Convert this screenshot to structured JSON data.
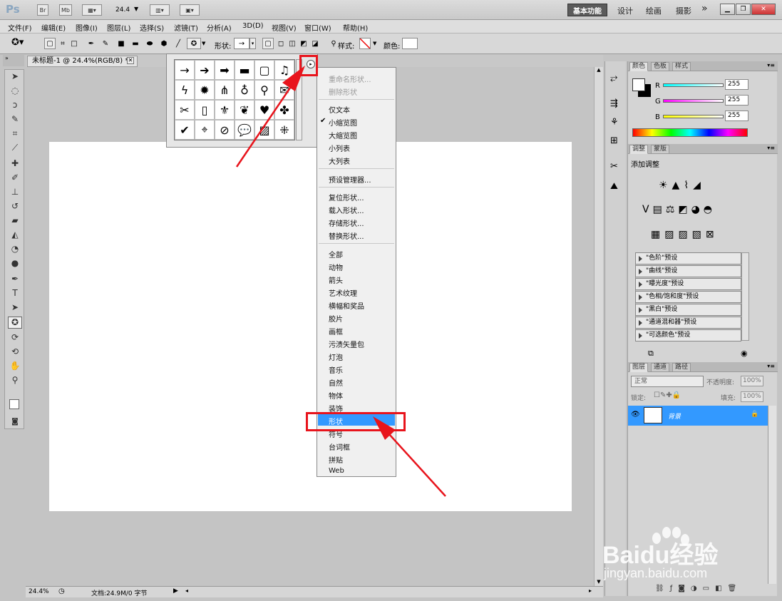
{
  "app": {
    "logo": "Ps",
    "launch_br": "Br",
    "launch_mb": "Mb",
    "zoom_value": "24.4",
    "workspaces": {
      "active": "基本功能",
      "items": [
        "设计",
        "绘画",
        "摄影"
      ],
      "more": "»"
    }
  },
  "menubar": [
    "文件(F)",
    "编辑(E)",
    "图像(I)",
    "图层(L)",
    "选择(S)",
    "滤镜(T)",
    "分析(A)",
    "3D(D)",
    "视图(V)",
    "窗口(W)",
    "帮助(H)"
  ],
  "options": {
    "shape_label": "形状:",
    "style_label": "样式:",
    "color_label": "颜色:"
  },
  "document": {
    "tab_title": "未标题-1 @ 24.4%(RGB/8) *",
    "status_zoom": "24.4%",
    "status_doc": "文档:24.9M/0 字节"
  },
  "context_menu": {
    "group1": [
      "重命名形状...",
      "删除形状"
    ],
    "group2": [
      "仅文本",
      "小缩览图",
      "大缩览图",
      "小列表",
      "大列表"
    ],
    "checked": "小缩览图",
    "group3": [
      "预设管理器..."
    ],
    "group4": [
      "复位形状...",
      "载入形状...",
      "存储形状...",
      "替换形状..."
    ],
    "group5": [
      "全部",
      "动物",
      "箭头",
      "艺术纹理",
      "横幅和奖品",
      "胶片",
      "画框",
      "污渍矢量包",
      "灯泡",
      "音乐",
      "自然",
      "物体",
      "装饰",
      "形状",
      "符号",
      "台词框",
      "拼贴",
      "Web"
    ],
    "highlighted": "形状"
  },
  "color_panel": {
    "tabs": [
      "颜色",
      "色板",
      "样式"
    ],
    "channels": [
      {
        "label": "R",
        "value": "255",
        "color": "#00ffff"
      },
      {
        "label": "G",
        "value": "255",
        "color": "#ff00ff"
      },
      {
        "label": "B",
        "value": "255",
        "color": "#ffff00"
      }
    ]
  },
  "adjust_panel": {
    "tabs": [
      "调整",
      "蒙版"
    ],
    "title": "添加调整",
    "presets": [
      "\"色阶\"预设",
      "\"曲线\"预设",
      "\"曝光度\"预设",
      "\"色相/饱和度\"预设",
      "\"黑白\"预设",
      "\"通道混和器\"预设",
      "\"可选颜色\"预设"
    ]
  },
  "layers_panel": {
    "tabs": [
      "图层",
      "通道",
      "路径"
    ],
    "blend_mode": "正常",
    "opacity_label": "不透明度:",
    "opacity": "100%",
    "lock_label": "锁定:",
    "fill_label": "填充:",
    "fill": "100%",
    "layer_name": "背景"
  },
  "watermark": {
    "brand": "Baidu经验",
    "url": "jingyan.baidu.com"
  },
  "colors": {
    "accent": "#3399ff",
    "annotation": "#e8141c"
  }
}
